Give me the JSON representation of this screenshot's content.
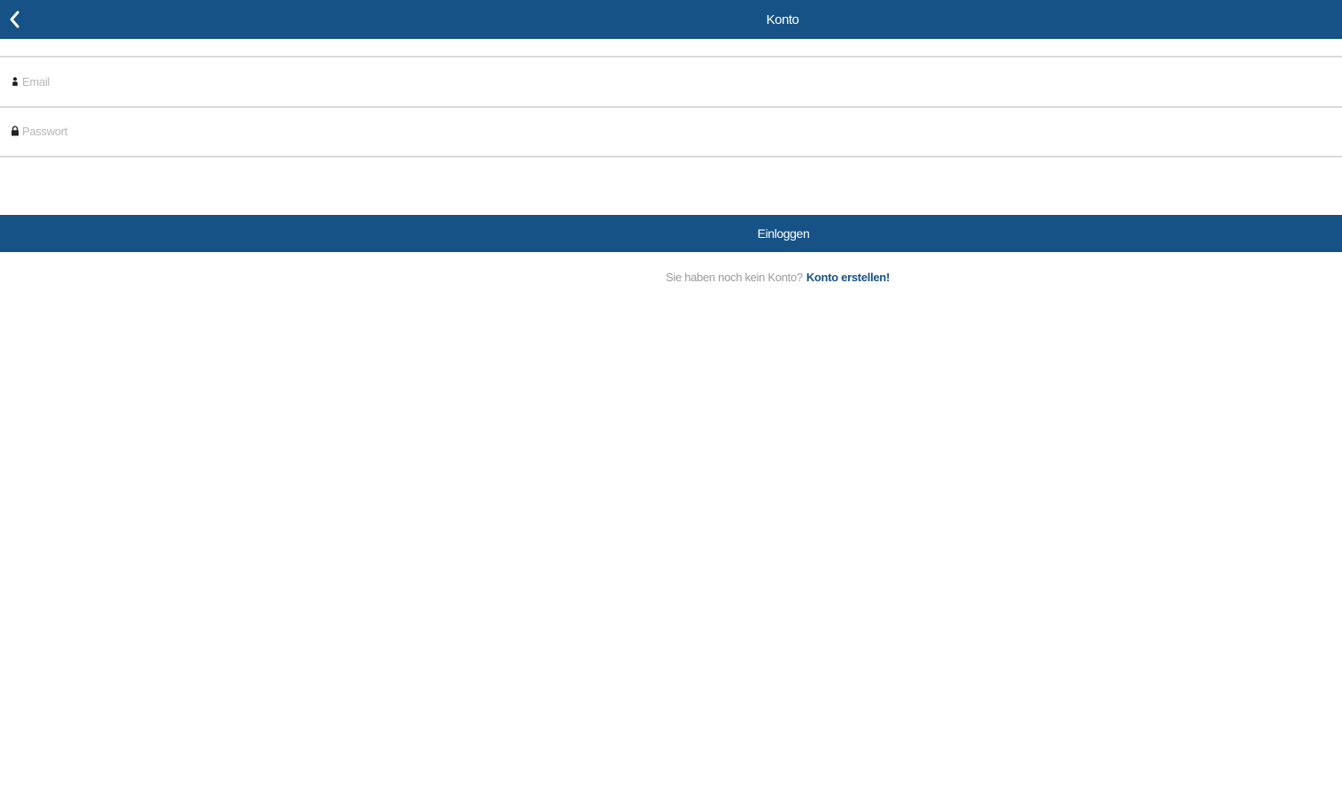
{
  "header": {
    "title": "Konto",
    "back_icon": "chevron-left-icon",
    "color": "#165285"
  },
  "form": {
    "email": {
      "placeholder": "Email",
      "value": "",
      "icon": "person-icon"
    },
    "password": {
      "placeholder": "Passwort",
      "value": "",
      "icon": "lock-icon"
    }
  },
  "actions": {
    "login_label": "Einloggen"
  },
  "signup": {
    "prompt": "Sie haben noch kein Konto?",
    "link_label": "Konto erstellen!"
  },
  "colors": {
    "primary": "#165285",
    "divider": "#d9d9d9",
    "muted_text": "#9a9a9a"
  }
}
